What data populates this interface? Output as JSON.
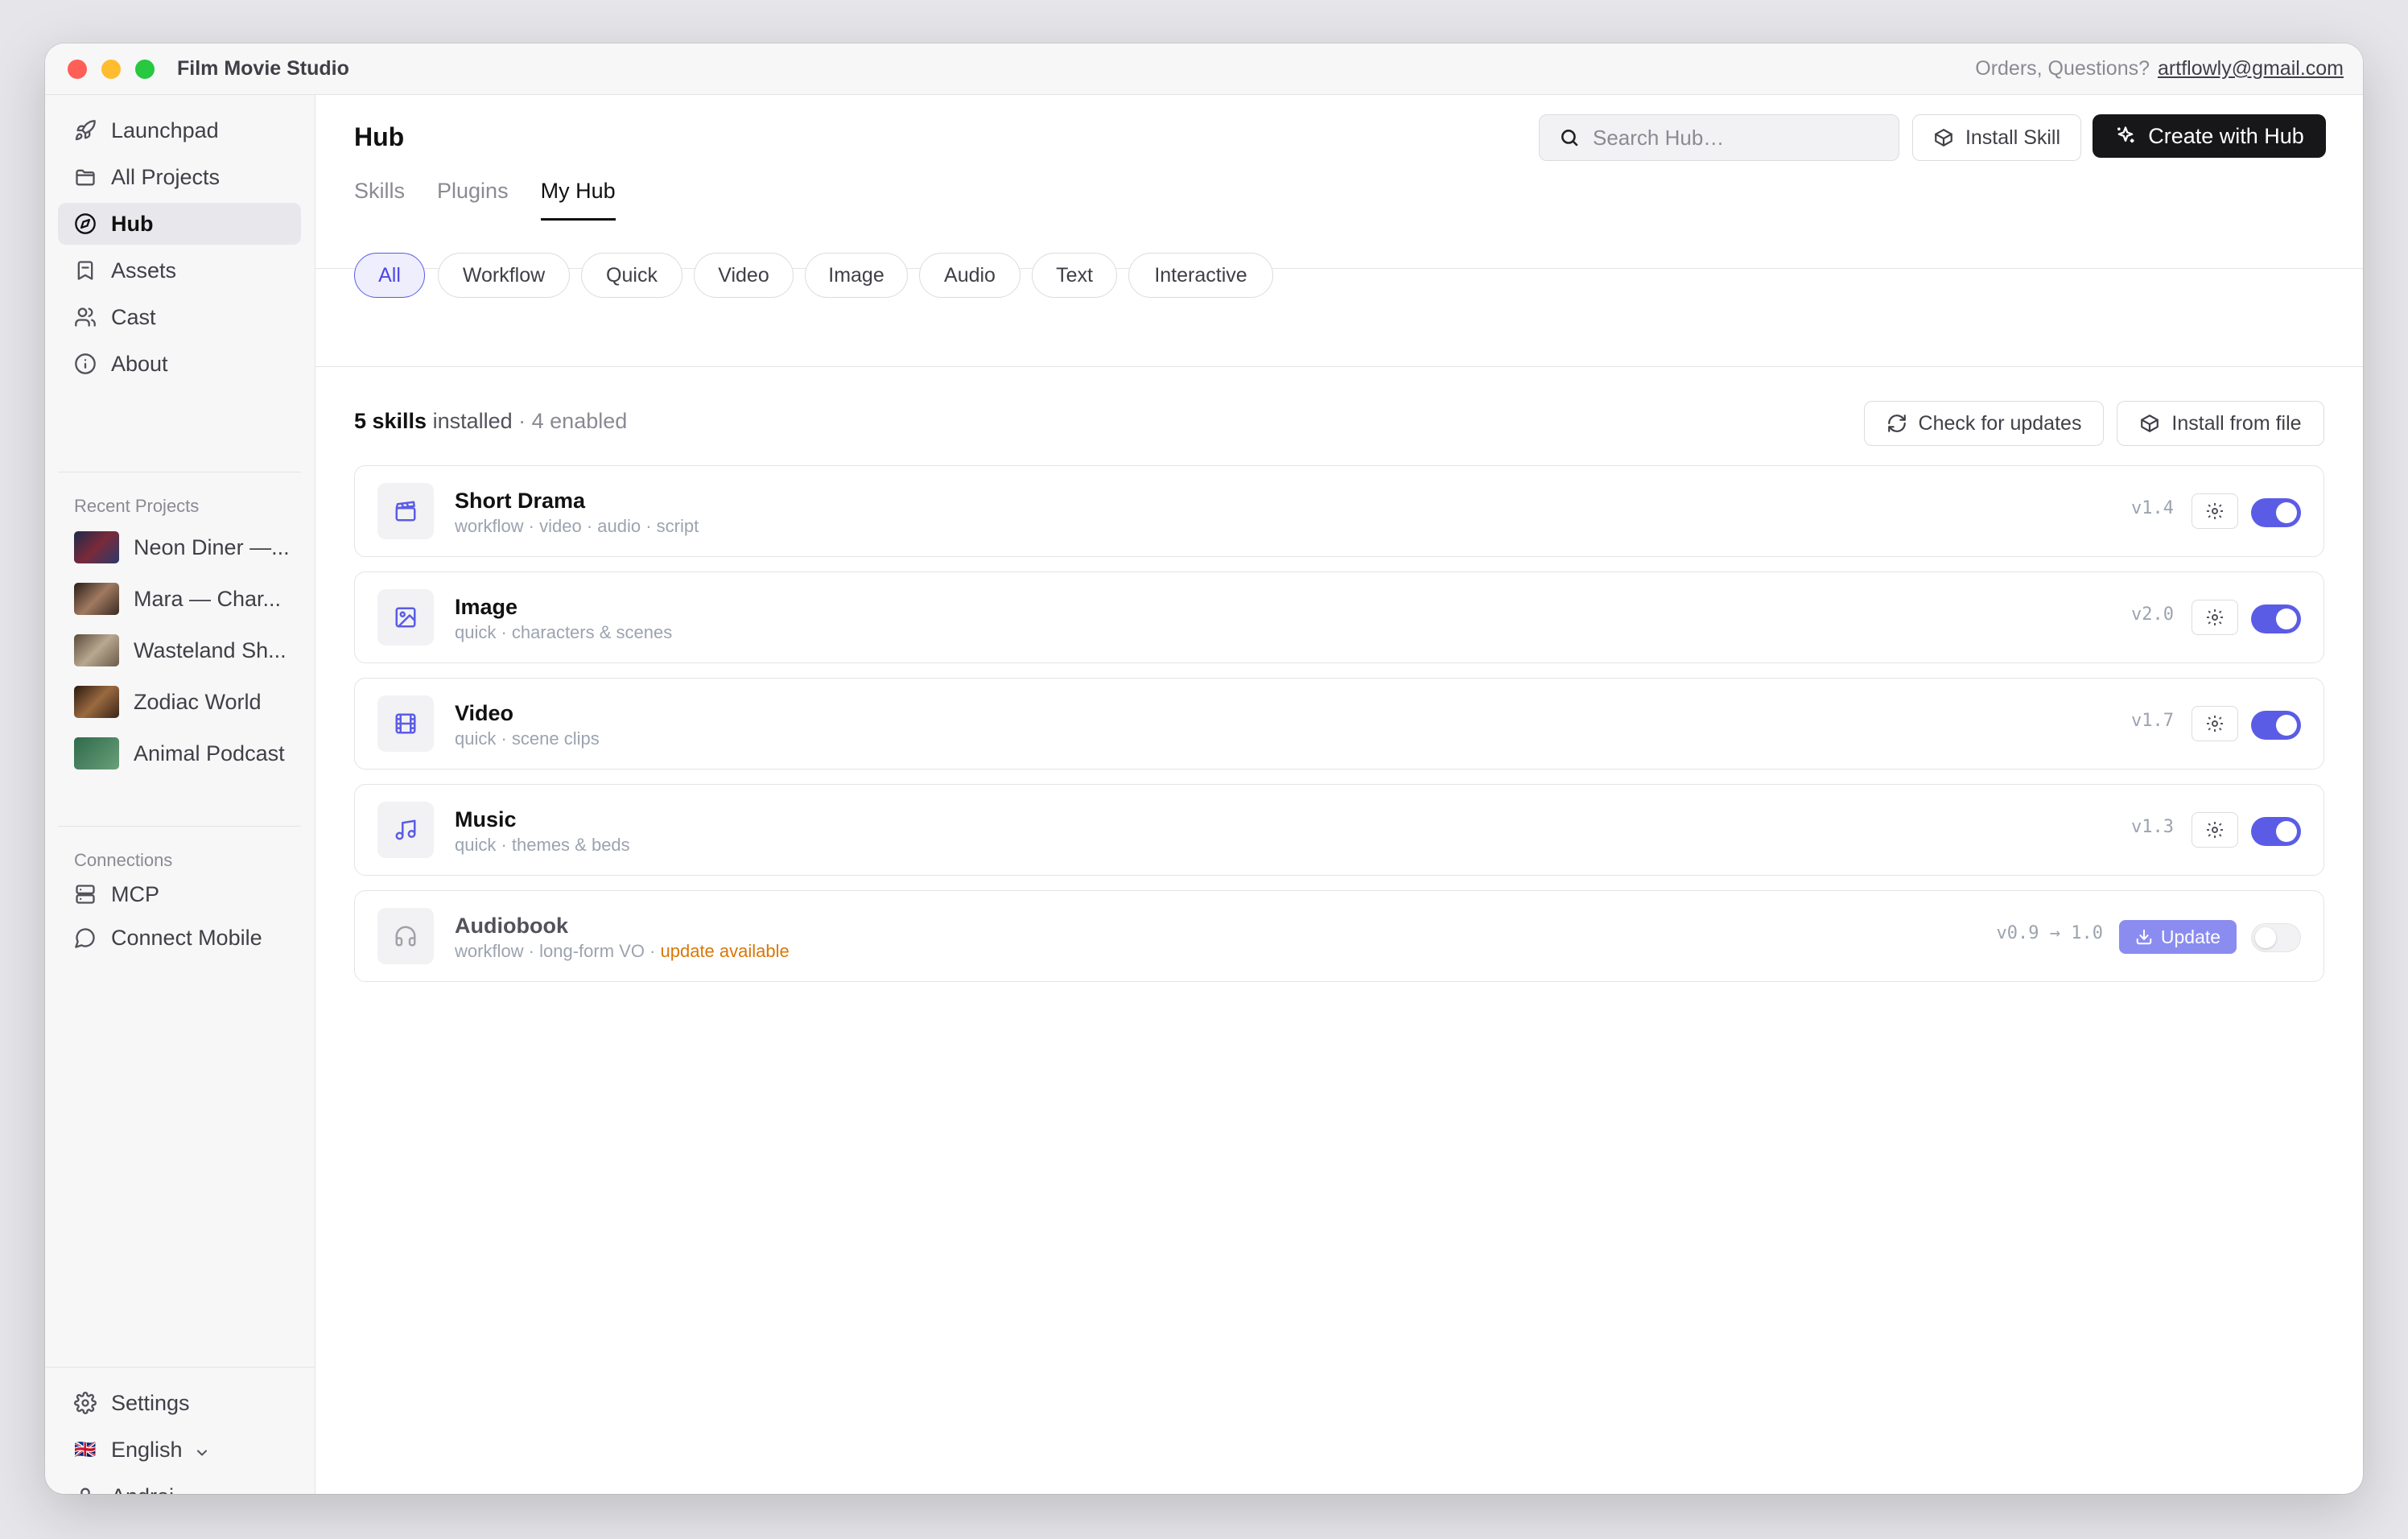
{
  "window": {
    "title": "Film Movie Studio",
    "top_right_text": "Orders, Questions?",
    "email": "artflowly@gmail.com"
  },
  "sidebar": {
    "nav": [
      {
        "label": "Launchpad",
        "icon": "rocket-icon"
      },
      {
        "label": "All Projects",
        "icon": "folder-icon"
      },
      {
        "label": "Hub",
        "icon": "compass-icon",
        "active": true
      },
      {
        "label": "Assets",
        "icon": "bookmark-icon"
      },
      {
        "label": "Cast",
        "icon": "users-icon"
      },
      {
        "label": "About",
        "icon": "info-icon"
      }
    ],
    "recent_title": "Recent Projects",
    "recent": [
      {
        "label": "Neon Diner —...",
        "thumb": "#3a2a4a"
      },
      {
        "label": "Mara — Char...",
        "thumb": "#5a3e30"
      },
      {
        "label": "Wasteland Sh...",
        "thumb": "#7a6a58"
      },
      {
        "label": "Zodiac World",
        "thumb": "#4a2e1e"
      },
      {
        "label": "Animal Podcast",
        "thumb": "#3f7a5a"
      }
    ],
    "connections_title": "Connections",
    "connections": [
      {
        "label": "MCP",
        "icon": "server-icon"
      },
      {
        "label": "Connect Mobile",
        "icon": "chat-icon"
      }
    ],
    "settings": "Settings",
    "language": "English",
    "language_flag": "🇬🇧",
    "user": "Andrej"
  },
  "header": {
    "title": "Hub",
    "search_placeholder": "Search Hub…",
    "install_skill": "Install Skill",
    "create": "Create with Hub"
  },
  "tabs": [
    "Skills",
    "Plugins",
    "My Hub"
  ],
  "active_tab": "My Hub",
  "filters": [
    "All",
    "Workflow",
    "Quick",
    "Video",
    "Image",
    "Audio",
    "Text",
    "Interactive"
  ],
  "active_filter": "All",
  "summary": {
    "count": "5 skills",
    "installed": " installed",
    "enabled": " · 4 enabled"
  },
  "actions": {
    "check_updates": "Check for updates",
    "install_file": "Install from file"
  },
  "skills": [
    {
      "name": "Short Drama",
      "meta": "workflow · video · audio · script",
      "version": "v1.4",
      "enabled": true,
      "icon": "clapperboard-icon"
    },
    {
      "name": "Image",
      "meta": "quick · characters & scenes",
      "version": "v2.0",
      "enabled": true,
      "icon": "image-icon"
    },
    {
      "name": "Video",
      "meta": "quick · scene clips",
      "version": "v1.7",
      "enabled": true,
      "icon": "film-icon"
    },
    {
      "name": "Music",
      "meta": "quick · themes & beds",
      "version": "v1.3",
      "enabled": true,
      "icon": "music-icon"
    },
    {
      "name": "Audiobook",
      "meta": "workflow · long-form VO · ",
      "meta_highlight": "update available",
      "version": "v0.9 → 1.0",
      "enabled": false,
      "icon": "headphones-icon",
      "update_label": "Update"
    }
  ],
  "colors": {
    "accent": "#5b5ce6",
    "warning": "#d97706",
    "dark_button": "#17171a"
  }
}
